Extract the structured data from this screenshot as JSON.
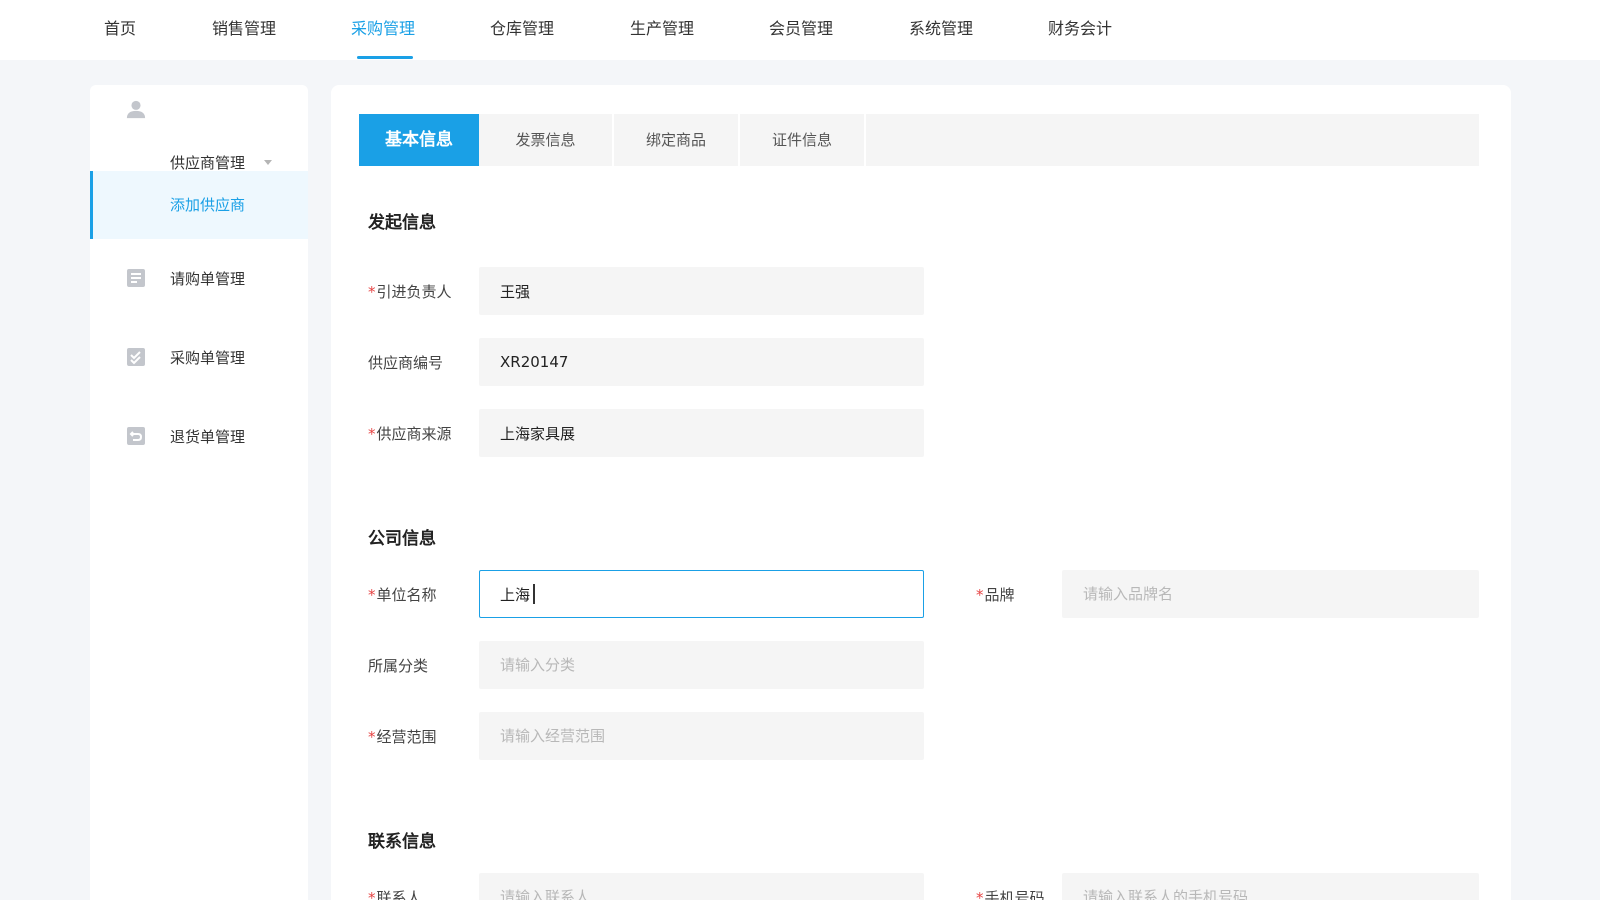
{
  "nav": {
    "items": [
      "首页",
      "销售管理",
      "采购管理",
      "仓库管理",
      "生产管理",
      "会员管理",
      "系统管理",
      "财务会计"
    ],
    "active_index": 2
  },
  "sidebar": {
    "group_label": "供应商管理",
    "items": [
      {
        "label": "添加供应商",
        "icon": "none",
        "active": true
      },
      {
        "label": "请购单管理",
        "icon": "document-icon"
      },
      {
        "label": "采购单管理",
        "icon": "checklist-icon"
      },
      {
        "label": "退货单管理",
        "icon": "return-icon"
      }
    ]
  },
  "tabs": [
    "基本信息",
    "发票信息",
    "绑定商品",
    "证件信息"
  ],
  "sections": {
    "initiation": {
      "title": "发起信息",
      "fields": [
        {
          "label": "引进负责人",
          "required": true,
          "value": "王强"
        },
        {
          "label": "供应商编号",
          "required": false,
          "value": "XR20147"
        },
        {
          "label": "供应商来源",
          "required": true,
          "value": "上海家具展"
        }
      ]
    },
    "company": {
      "title": "公司信息",
      "unit_name": {
        "label": "单位名称",
        "required": true,
        "value": "上海"
      },
      "brand": {
        "label": "品牌",
        "required": true,
        "placeholder": "请输入品牌名"
      },
      "category": {
        "label": "所属分类",
        "required": false,
        "placeholder": "请输入分类"
      },
      "scope": {
        "label": "经营范围",
        "required": true,
        "placeholder": "请输入经营范围"
      }
    },
    "contact": {
      "title": "联系信息",
      "contact_person": {
        "label": "联系人",
        "required": true,
        "placeholder": "请输入联系人"
      },
      "phone": {
        "label": "手机号码",
        "required": true,
        "placeholder": "请输入联系人的手机号码"
      }
    }
  },
  "colors": {
    "accent": "#1aa0e6",
    "required": "#e64545",
    "input_bg": "#f5f5f5"
  }
}
